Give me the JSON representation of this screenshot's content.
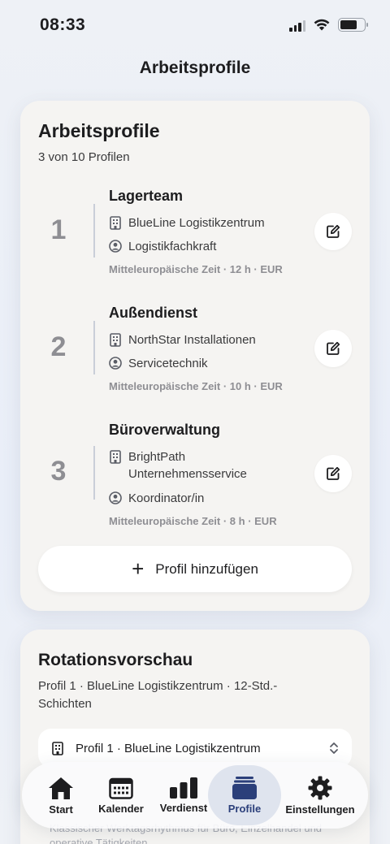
{
  "status": {
    "time": "08:33"
  },
  "nav": {
    "title": "Arbeitsprofile"
  },
  "profiles_card": {
    "title": "Arbeitsprofile",
    "subtitle": "3 von 10 Profilen",
    "profiles": [
      {
        "number": "1",
        "name": "Lagerteam",
        "company": "BlueLine Logistikzentrum",
        "role": "Logistikfachkraft",
        "meta": "Mitteleuropäische Zeit · 12 h · EUR"
      },
      {
        "number": "2",
        "name": "Außendienst",
        "company": "NorthStar Installationen",
        "role": "Servicetechnik",
        "meta": "Mitteleuropäische Zeit · 10 h · EUR"
      },
      {
        "number": "3",
        "name": "Büroverwaltung",
        "company": "BrightPath Unternehmensservice",
        "company_line1": "BrightPath",
        "company_line2": "Unternehmensservice",
        "role": "Koordinator/in",
        "meta": "Mitteleuropäische Zeit · 8 h · EUR"
      }
    ],
    "add_button": {
      "icon": "plus-icon",
      "label": "Profil hinzufügen"
    }
  },
  "rotation_card": {
    "title": "Rotationsvorschau",
    "subtitle": "Profil 1 · BlueLine Logistikzentrum · 12-Std.-Schichten",
    "select_value": "Profil 1 · BlueLine Logistikzentrum",
    "faded_text": "Klassischer Werktagsrhythmus für Büro, Einzelhandel und operative Tätigkeiten"
  },
  "tabbar": {
    "active": "Profile",
    "tabs": [
      {
        "label": "Start",
        "icon": "home-icon"
      },
      {
        "label": "Kalender",
        "icon": "calendar-icon"
      },
      {
        "label": "Verdienst",
        "icon": "bar-chart-icon"
      },
      {
        "label": "Profile",
        "icon": "profiles-stack-icon"
      },
      {
        "label": "Einstellungen",
        "icon": "gear-icon"
      }
    ]
  },
  "colors": {
    "accent": "#2b3f7a",
    "card_bg": "#f5f4f2",
    "muted": "#8e8e93"
  }
}
